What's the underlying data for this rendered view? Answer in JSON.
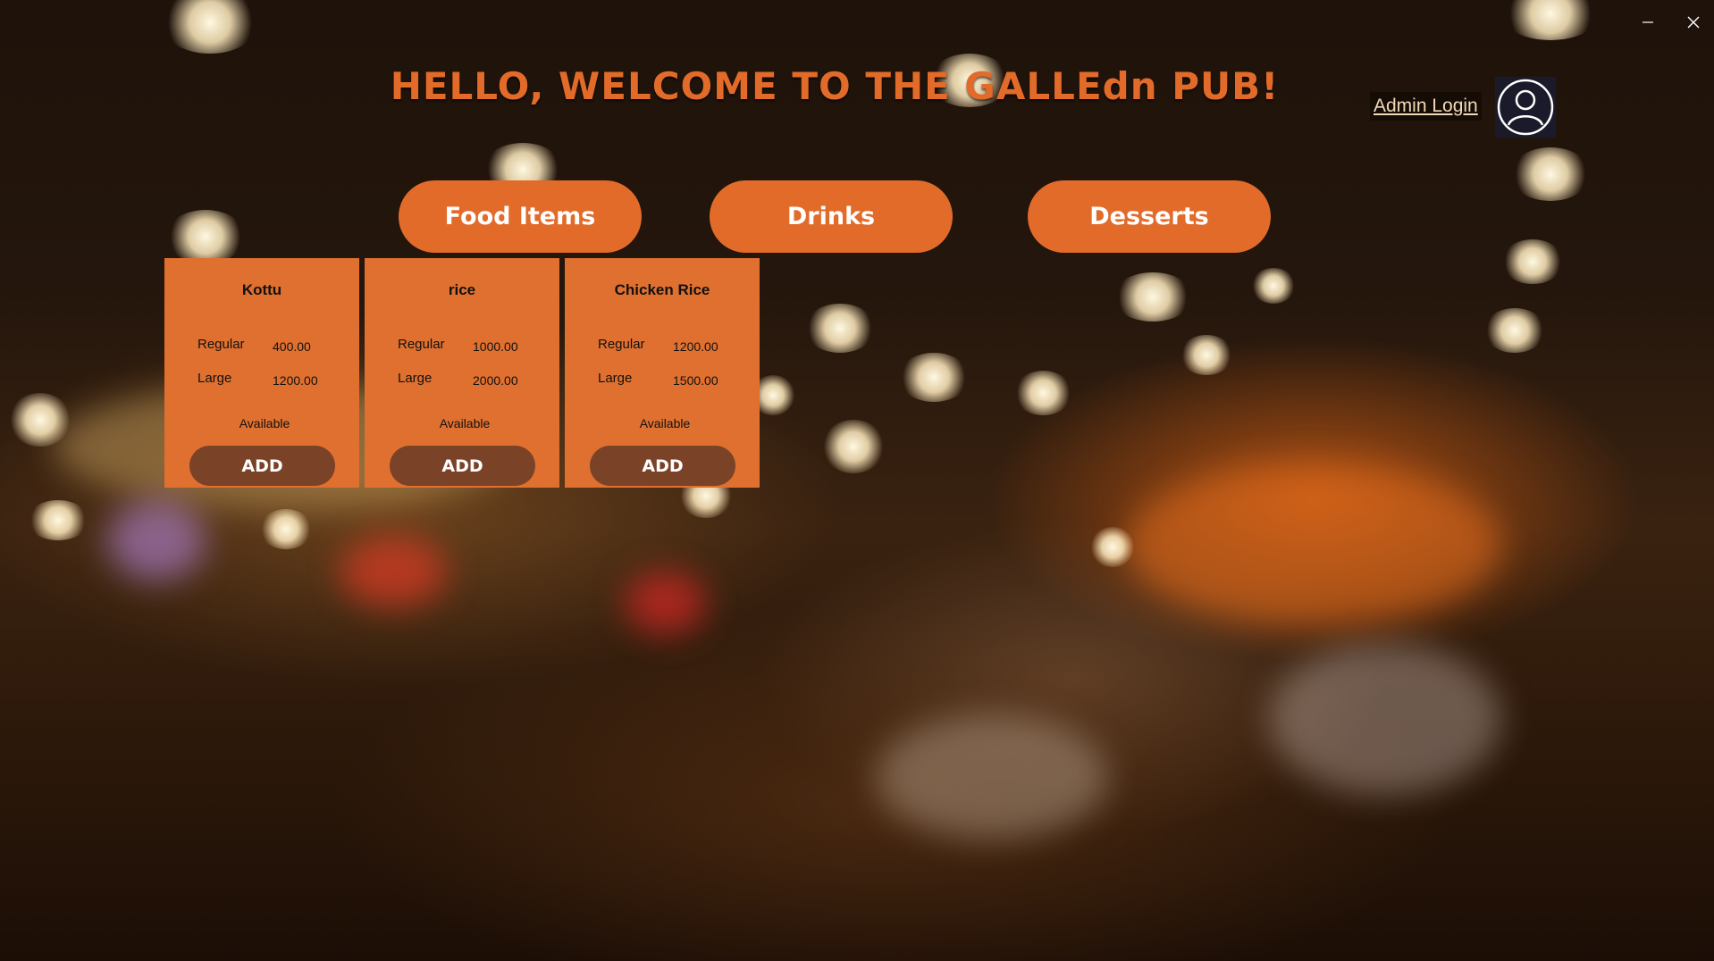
{
  "window": {
    "minimize_icon": "minimize-icon",
    "close_icon": "close-icon"
  },
  "header": {
    "title": "HELLO, WELCOME TO THE GALLEdn PUB!",
    "admin_login": "Admin Login",
    "avatar_icon": "user-avatar-icon"
  },
  "categories": [
    {
      "label": "Food Items"
    },
    {
      "label": "Drinks"
    },
    {
      "label": "Desserts"
    }
  ],
  "items": [
    {
      "name": "Kottu",
      "regular_label": "Regular",
      "regular_price": "400.00",
      "large_label": "Large",
      "large_price": "1200.00",
      "status": "Available",
      "add_label": "ADD"
    },
    {
      "name": "rice",
      "regular_label": "Regular",
      "regular_price": "1000.00",
      "large_label": "Large",
      "large_price": "2000.00",
      "status": "Available",
      "add_label": "ADD"
    },
    {
      "name": "Chicken Rice",
      "regular_label": "Regular",
      "regular_price": "1200.00",
      "large_label": "Large",
      "large_price": "1500.00",
      "status": "Available",
      "add_label": "ADD"
    }
  ],
  "colors": {
    "accent": "#e26b2a",
    "card": "#e0702f",
    "add_button": "#7a4327"
  }
}
